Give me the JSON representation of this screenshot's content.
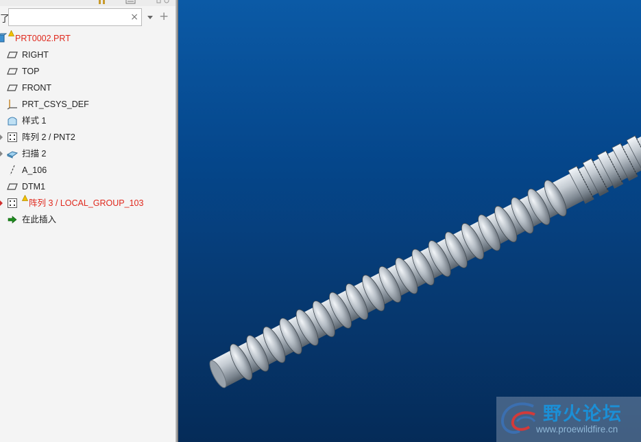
{
  "search": {
    "value": "",
    "placeholder": "",
    "clear_glyph": "×",
    "add_glyph": "+"
  },
  "filter_glyph": "了",
  "tree": {
    "root": {
      "label": "PRT0002.PRT",
      "status": "warning",
      "icon": "part-icon"
    },
    "items": [
      {
        "label": "RIGHT",
        "icon": "datum-plane-icon",
        "expandable": false
      },
      {
        "label": "TOP",
        "icon": "datum-plane-icon",
        "expandable": false
      },
      {
        "label": "FRONT",
        "icon": "datum-plane-icon",
        "expandable": false
      },
      {
        "label": "PRT_CSYS_DEF",
        "icon": "coordinate-system-icon",
        "expandable": false
      },
      {
        "label": "样式 1",
        "icon": "style-feature-icon",
        "expandable": false
      },
      {
        "label": "阵列 2 / PNT2",
        "icon": "pattern-icon",
        "expandable": true
      },
      {
        "label": "扫描 2",
        "icon": "sweep-icon",
        "expandable": true
      },
      {
        "label": "A_106",
        "icon": "datum-axis-icon",
        "expandable": false
      },
      {
        "label": "DTM1",
        "icon": "datum-plane-icon",
        "expandable": false
      },
      {
        "label": "阵列 3 / LOCAL_GROUP_103",
        "icon": "pattern-icon",
        "expandable": true,
        "status": "warning"
      },
      {
        "label": "在此插入",
        "icon": "insert-here-arrow-icon",
        "expandable": false
      }
    ]
  },
  "colors": {
    "error_text": "#e0281c",
    "warning_icon": "#f2c200",
    "viewport_top": "#0b5aa6",
    "viewport_bottom": "#052b58",
    "model_gray": "#a8b0b8"
  },
  "watermark": {
    "title": "野火论坛",
    "url": "www.proewildfire.cn"
  }
}
